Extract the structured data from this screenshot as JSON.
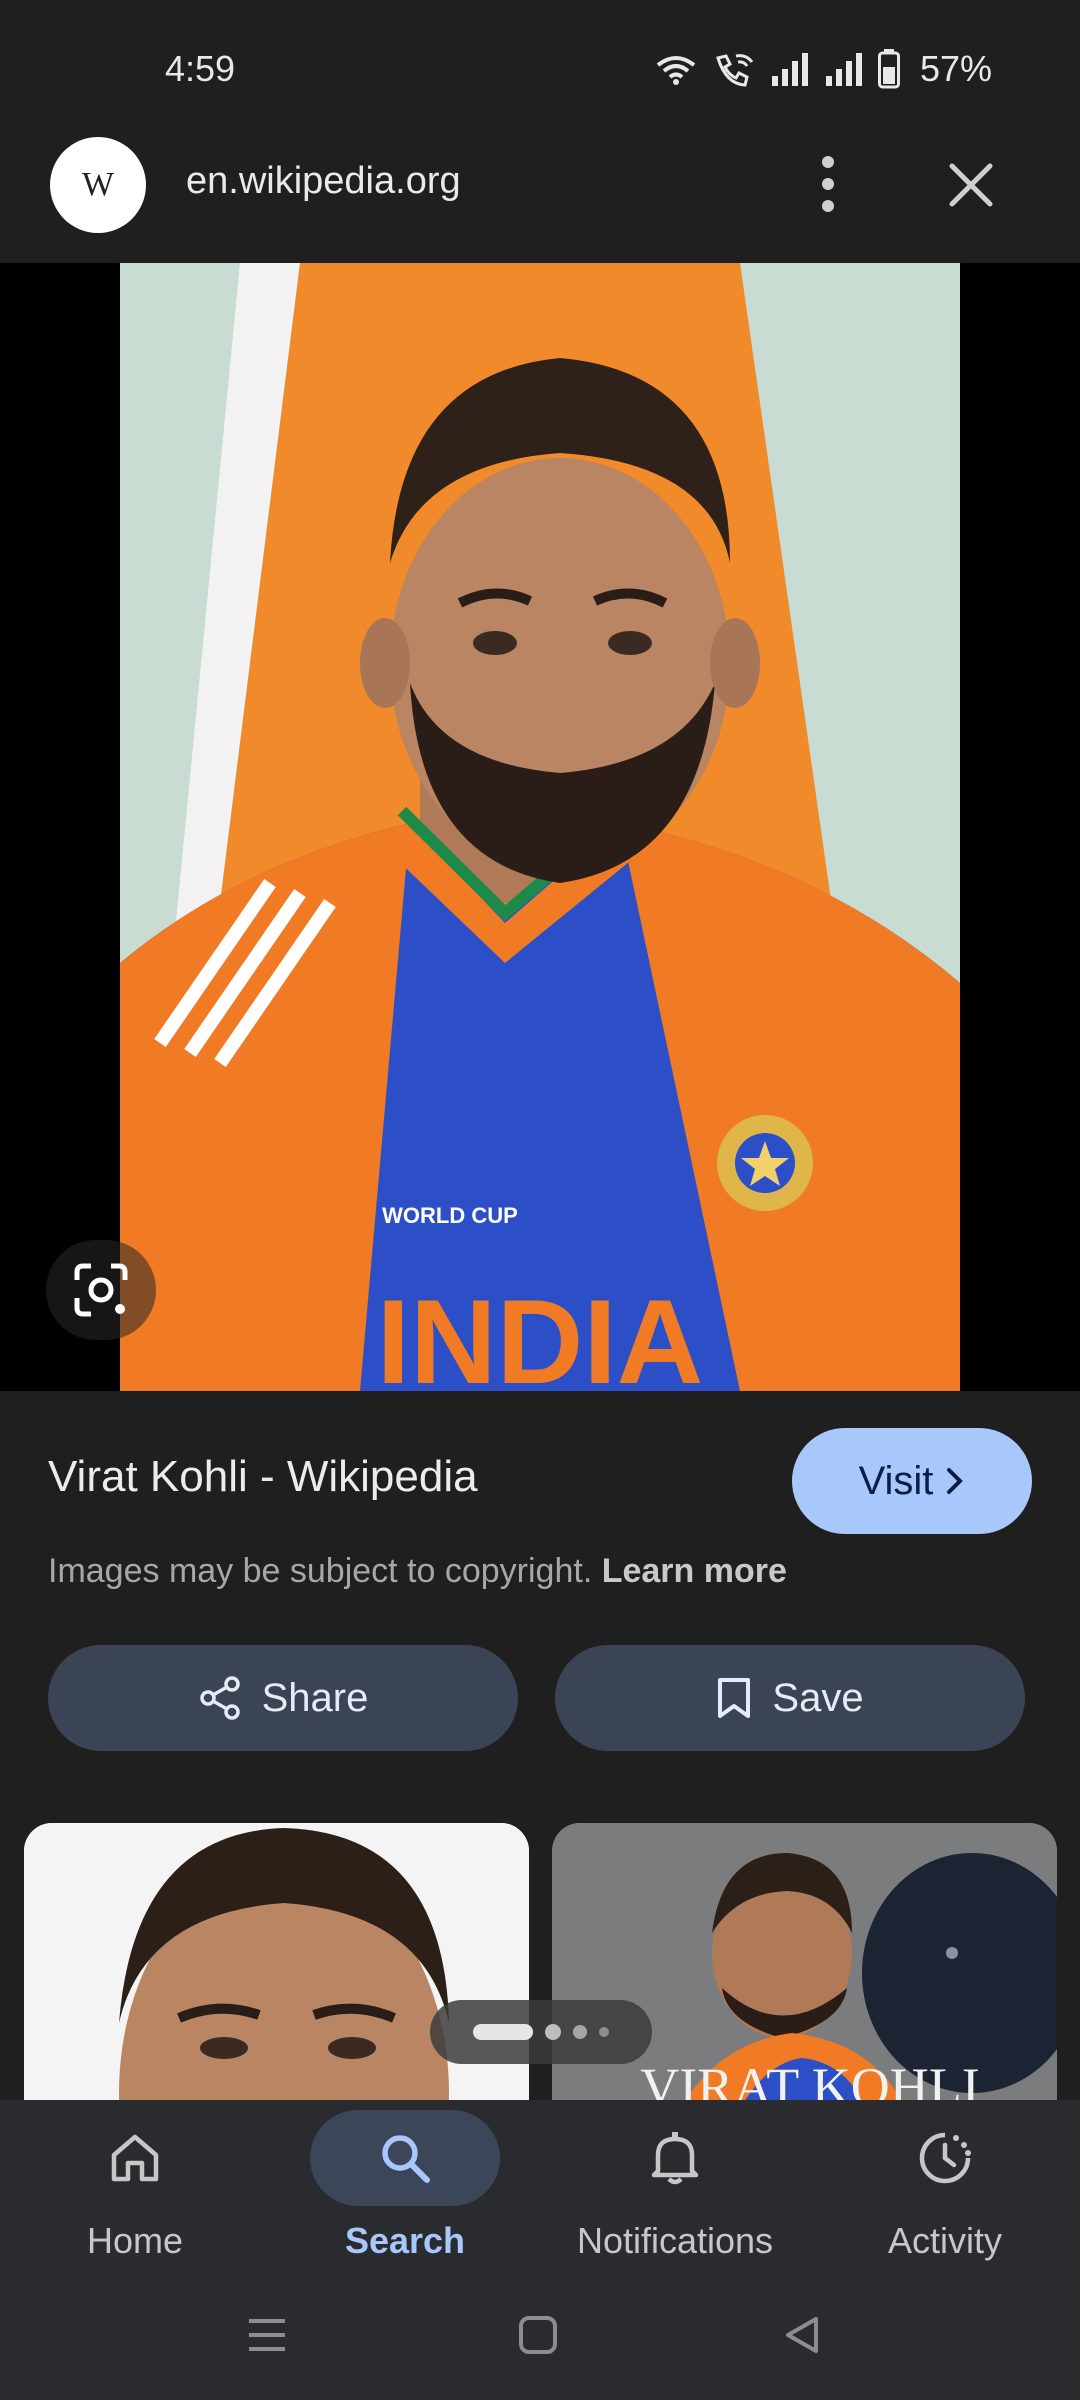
{
  "status": {
    "time": "4:59",
    "battery": "57%"
  },
  "browser": {
    "site_logo_letter": "W",
    "url": "en.wikipedia.org"
  },
  "result": {
    "title": "Virat Kohli - Wikipedia",
    "visit_label": "Visit",
    "copyright_text": "Images may be subject to copyright.",
    "learn_more": "Learn more",
    "share_label": "Share",
    "save_label": "Save"
  },
  "photo": {
    "jersey_text": "INDIA",
    "badge_text": "WORLD CUP"
  },
  "thumbs": [
    {
      "caption": ""
    },
    {
      "caption": "VIRAT KOHLI"
    }
  ],
  "nav": {
    "items": [
      {
        "label": "Home",
        "icon": "home-icon"
      },
      {
        "label": "Search",
        "icon": "search-icon",
        "active": true
      },
      {
        "label": "Notifications",
        "icon": "bell-icon"
      },
      {
        "label": "Activity",
        "icon": "activity-icon"
      }
    ]
  },
  "colors": {
    "accent": "#a8c7fa",
    "background": "#1f1f1f",
    "button": "#3b4454"
  }
}
